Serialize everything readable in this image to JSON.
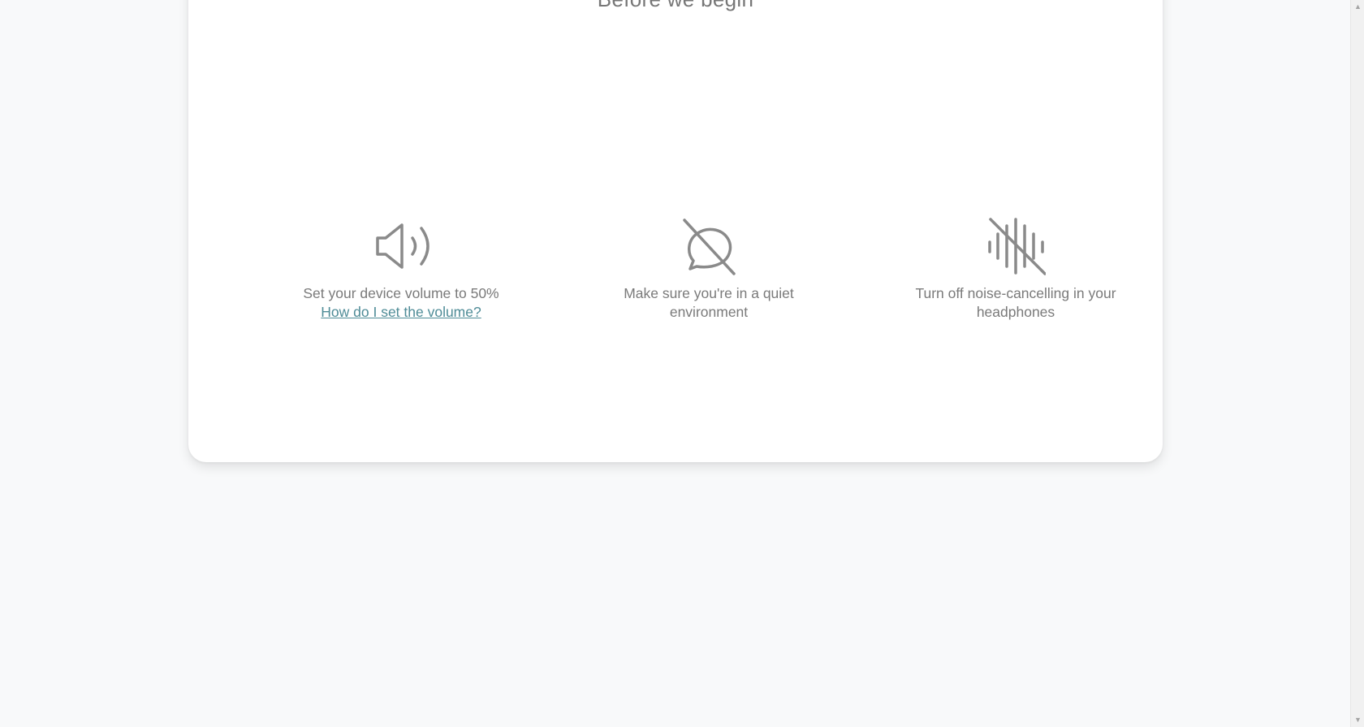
{
  "card": {
    "title": "Before we begin"
  },
  "tips": [
    {
      "icon": "speaker-volume-icon",
      "text": "Set your device volume to 50%",
      "link": "How do I set the volume?"
    },
    {
      "icon": "chat-bubble-off-icon",
      "text": "Make sure you're in a quiet environment"
    },
    {
      "icon": "sound-wave-off-icon",
      "text": "Turn off noise-cancelling in your headphones"
    }
  ],
  "colors": {
    "background": "#f8f9fa",
    "card": "#ffffff",
    "text": "#7a7a7a",
    "icon": "#8a8a8a",
    "link": "#4f8c97"
  },
  "scrollbar": {
    "up_arrow": "▲",
    "down_arrow": "▼"
  }
}
